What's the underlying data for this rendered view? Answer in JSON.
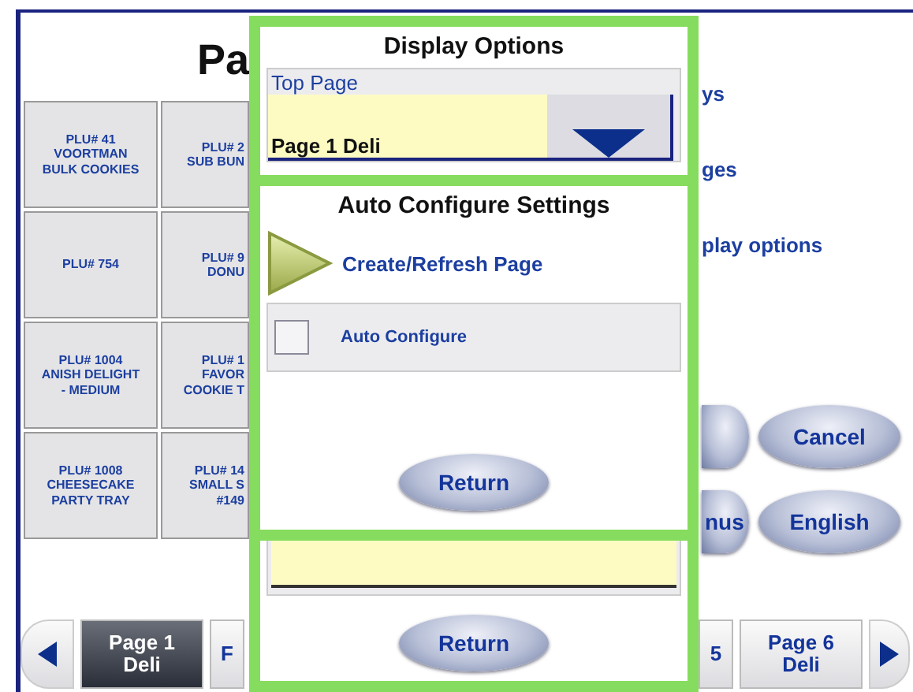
{
  "background": {
    "title": "Pa",
    "plu_buttons": [
      {
        "lines": [
          "PLU# 41",
          "VOORTMAN",
          "BULK COOKIES"
        ]
      },
      {
        "lines": [
          "PLU# 2",
          "SUB BUN"
        ]
      },
      {
        "lines": [
          "PLU# 754"
        ]
      },
      {
        "lines": [
          "PLU# 9",
          "DONU"
        ]
      },
      {
        "lines": [
          "PLU# 1004",
          "ANISH DELIGHT",
          "- MEDIUM"
        ]
      },
      {
        "lines": [
          "PLU# 1",
          "FAVOR",
          "COOKIE T"
        ]
      },
      {
        "lines": [
          "PLU# 1008",
          "CHEESECAKE",
          "PARTY TRAY"
        ]
      },
      {
        "lines": [
          "PLU# 14",
          "SMALL S",
          "#149"
        ]
      }
    ],
    "links": [
      "ys",
      "ges",
      "play options"
    ],
    "ovals": [
      {
        "kind": "blank"
      },
      {
        "kind": "labelled",
        "label": "Cancel"
      },
      {
        "kind": "labelled",
        "label": "nus"
      },
      {
        "kind": "labelled",
        "label": "English"
      }
    ],
    "nav": {
      "left_tabs": [
        {
          "label": "Page 1\nDeli",
          "selected": true
        },
        {
          "label": "F",
          "selected": false
        }
      ],
      "right_tabs": [
        {
          "label": "5",
          "selected": false
        },
        {
          "label": "Page 6\nDeli",
          "selected": false
        }
      ]
    }
  },
  "display_options": {
    "title": "Display Options",
    "top_page": {
      "label": "Top Page",
      "value": "Page 1 Deli"
    },
    "return": "Return"
  },
  "auto_configure_settings": {
    "title": "Auto Configure Settings",
    "action": "Create/Refresh Page",
    "auto_configure": {
      "label": "Auto Configure",
      "checked": false
    },
    "return": "Return"
  }
}
